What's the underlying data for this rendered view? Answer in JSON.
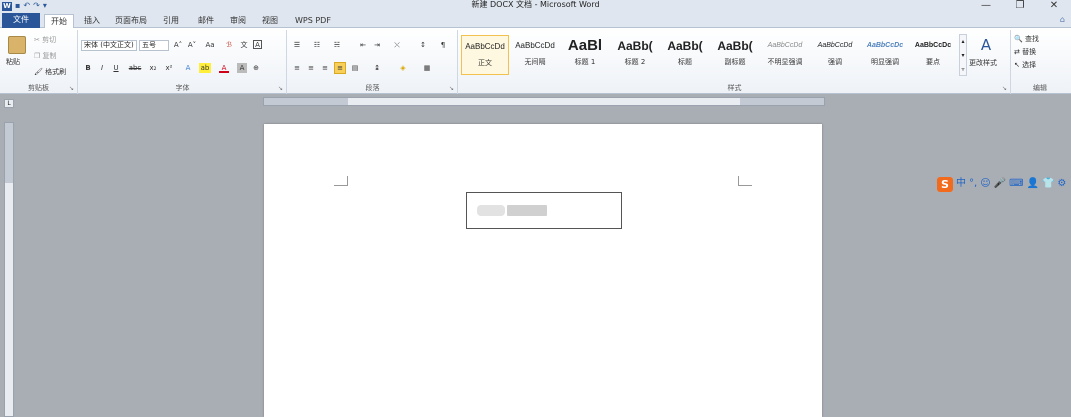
{
  "window": {
    "title": "新建 DOCX 文档 - Microsoft Word",
    "minimize": "—",
    "restore": "❐",
    "close": "✕"
  },
  "qat": {
    "logo": "W",
    "save": "▪",
    "undo": "↶",
    "redo": "↷",
    "more": "▾"
  },
  "tabs": [
    {
      "label": "文件"
    },
    {
      "label": "开始"
    },
    {
      "label": "插入"
    },
    {
      "label": "页面布局"
    },
    {
      "label": "引用"
    },
    {
      "label": "邮件"
    },
    {
      "label": "审阅"
    },
    {
      "label": "视图"
    },
    {
      "label": "WPS PDF"
    }
  ],
  "help_icon": "⌂",
  "clipboard": {
    "paste": "粘贴",
    "cut": "剪切",
    "copy": "复制",
    "format_painter": "格式刷",
    "label": "剪贴板"
  },
  "font": {
    "name": "宋体 (中文正文)",
    "size": "五号",
    "grow": "A˄",
    "shrink": "A˅",
    "change_case": "Aa",
    "clear": "ℬ",
    "phonetic": "文",
    "border": "A",
    "bold": "B",
    "italic": "I",
    "underline": "U",
    "strike": "abc",
    "sub": "x₂",
    "sup": "x²",
    "effects": "A",
    "highlight": "ab",
    "color": "A",
    "shade": "A",
    "enclose": "⊕",
    "label": "字体"
  },
  "paragraph": {
    "bullets": "☰",
    "numbering": "☷",
    "multilevel": "☵",
    "dec_indent": "⇤",
    "inc_indent": "⇥",
    "chinese_layout": "⤬",
    "sort": "↕",
    "show_marks": "¶",
    "align_left": "≡",
    "center": "≡",
    "align_right": "≡",
    "justify": "≡",
    "distributed": "▤",
    "line_spacing": "↨",
    "shading": "◈",
    "borders": "▦",
    "label": "段落"
  },
  "styles": {
    "items": [
      {
        "sample": "AaBbCcDd",
        "name": "正文"
      },
      {
        "sample": "AaBbCcDd",
        "name": "无间隔"
      },
      {
        "sample": "AaBl",
        "name": "标题 1"
      },
      {
        "sample": "AaBb(",
        "name": "标题 2"
      },
      {
        "sample": "AaBb(",
        "name": "标题"
      },
      {
        "sample": "AaBb(",
        "name": "副标题"
      },
      {
        "sample": "AaBbCcDd",
        "name": "不明显强调"
      },
      {
        "sample": "AaBbCcDd",
        "name": "强调"
      },
      {
        "sample": "AaBbCcDc",
        "name": "明显强调"
      },
      {
        "sample": "AaBbCcDc",
        "name": "要点"
      }
    ],
    "change_styles": "更改样式",
    "label": "样式"
  },
  "editing": {
    "find": "查找",
    "replace": "替换",
    "select": "选择",
    "label": "编辑"
  },
  "ruler": {
    "tab_selector": "L"
  },
  "ime": {
    "logo": "S",
    "lang": "中",
    "items": [
      "°,",
      "☺",
      "🎤",
      "⌨",
      "👤",
      "👕",
      "⚙"
    ]
  },
  "colors": {
    "file_tab": "#2a5699",
    "accent": "#2b579a",
    "ime_logo": "#f26b1d"
  }
}
